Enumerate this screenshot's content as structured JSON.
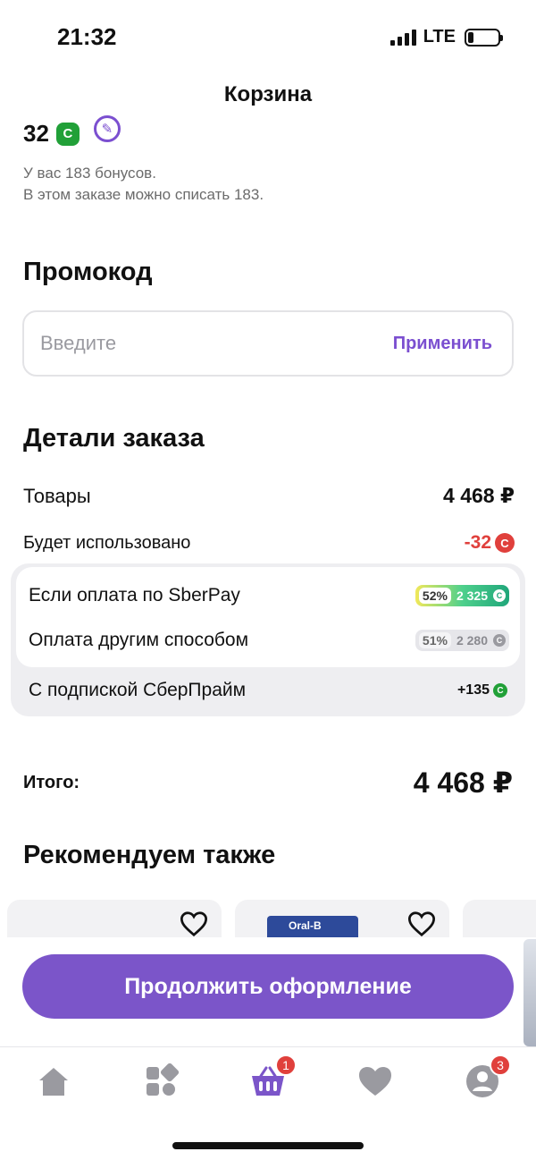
{
  "status": {
    "time": "21:32",
    "network": "LTE"
  },
  "header": {
    "title": "Корзина"
  },
  "bonuses": {
    "amount": "32",
    "coin_symbol": "С",
    "info_line1": "У вас 183 бонусов.",
    "info_line2": "В этом заказе можно списать 183."
  },
  "promo": {
    "title": "Промокод",
    "placeholder": "Введите",
    "apply_label": "Применить"
  },
  "order": {
    "title": "Детали заказа",
    "goods_label": "Товары",
    "goods_value": "4 468 ₽",
    "used_label": "Будет использовано",
    "used_value": "-32",
    "sberpay_label": "Если оплата по SberPay",
    "sberpay_pct": "52%",
    "sberpay_bonus": "2 325",
    "other_label": "Оплата другим способом",
    "other_pct": "51%",
    "other_bonus": "2 280",
    "prime_label": "С подпиской СберПрайм",
    "prime_bonus": "+135"
  },
  "total": {
    "label": "Итого:",
    "value": "4 468 ₽"
  },
  "recommend": {
    "title": "Рекомендуем также",
    "product_thumb_text": "Oral-B"
  },
  "cta": {
    "label": "Продолжить оформление"
  },
  "tabbar": {
    "items": [
      {
        "name": "home",
        "icon": "home-icon"
      },
      {
        "name": "catalog",
        "icon": "catalog-icon"
      },
      {
        "name": "cart",
        "icon": "basket-icon",
        "badge": "1"
      },
      {
        "name": "favorites",
        "icon": "heart-icon"
      },
      {
        "name": "profile",
        "icon": "profile-icon",
        "badge": "3"
      }
    ]
  },
  "colors": {
    "accent": "#7b55c9",
    "bonus_green": "#21a038",
    "negative": "#e0403c"
  }
}
